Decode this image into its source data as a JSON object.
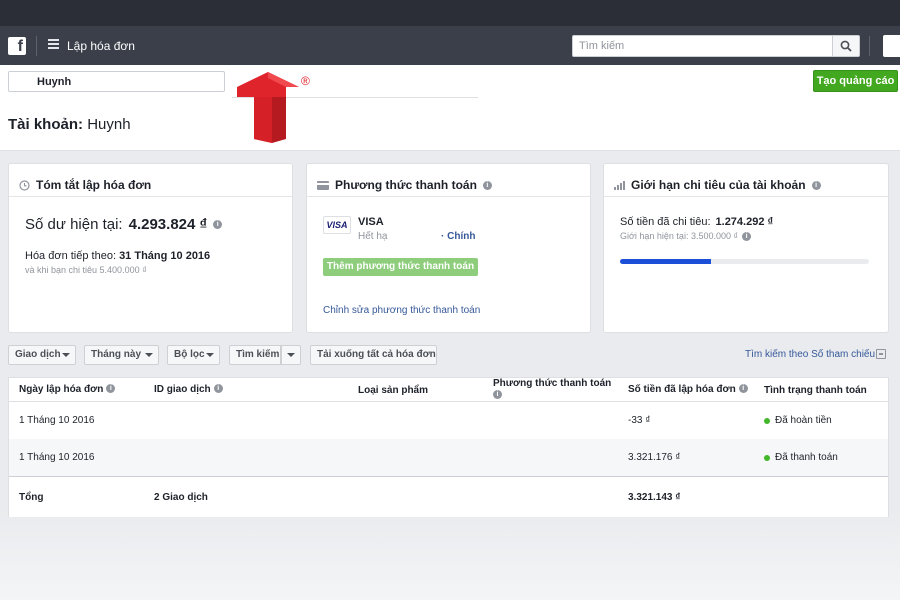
{
  "topbar": {
    "app_title": "Lập hóa đơn",
    "search_placeholder": "Tìm kiếm"
  },
  "subheader": {
    "account_name": "Huynh",
    "create_ad_label": "Tạo quảng cáo",
    "title_prefix": "Tài khoản:",
    "title_account": "Huynh"
  },
  "logo": {
    "letter": "T",
    "registered": "®",
    "colors": [
      "#e0242b",
      "#b51a20"
    ]
  },
  "summary_card": {
    "title": "Tóm tắt lập hóa đơn",
    "balance_label": "Số dư hiện tại:",
    "balance_value": "4.293.824 ₫",
    "next_invoice_label": "Hóa đơn tiếp theo:",
    "next_invoice_date": "31 Tháng 10 2016",
    "next_invoice_note": "và khi bạn chi tiêu 5.400.000 ₫"
  },
  "payment_card": {
    "title": "Phương thức thanh toán",
    "card_brand": "VISA",
    "card_name": "VISA",
    "expiry_prefix": "Hết hạ",
    "primary_label": "· Chính",
    "add_button": "Thêm phương thức thanh toán",
    "edit_link": "Chỉnh sửa phương thức thanh toán"
  },
  "limit_card": {
    "title": "Giới hạn chi tiêu của tài khoản",
    "spent_label": "Số tiền đã chi tiêu:",
    "spent_value": "1.274.292 ₫",
    "limit_text": "Giới hạn hiện tại: 3.500.000 ₫",
    "progress_fraction": 0.364
  },
  "toolbar": {
    "transactions": "Giao dịch",
    "this_month": "Tháng này",
    "filter": "Bộ lọc",
    "search": "Tìm kiếm",
    "download_all": "Tải xuống tất cả hóa đơn",
    "ref_search": "Tìm kiếm theo Số tham chiếu"
  },
  "table": {
    "columns": [
      "Ngày lập hóa đơn",
      "ID giao dịch",
      "Loại sản phẩm",
      "Phương thức thanh toán",
      "Số tiền đã lập hóa đơn",
      "Tình trạng thanh toán"
    ],
    "rows": [
      {
        "date": "1 Tháng 10 2016",
        "amount": "-33 ₫",
        "status": "Đã hoàn tiền"
      },
      {
        "date": "1 Tháng 10 2016",
        "amount": "3.321.176 ₫",
        "status": "Đã thanh toán"
      }
    ],
    "total": {
      "label": "Tổng",
      "count": "2 Giao dịch",
      "amount": "3.321.143 ₫"
    }
  },
  "colors": {
    "topbar": "#3b3f4a",
    "green": "#42a81f",
    "link": "#365899",
    "progress": "#1c4fd8",
    "status": "#42b72a"
  }
}
